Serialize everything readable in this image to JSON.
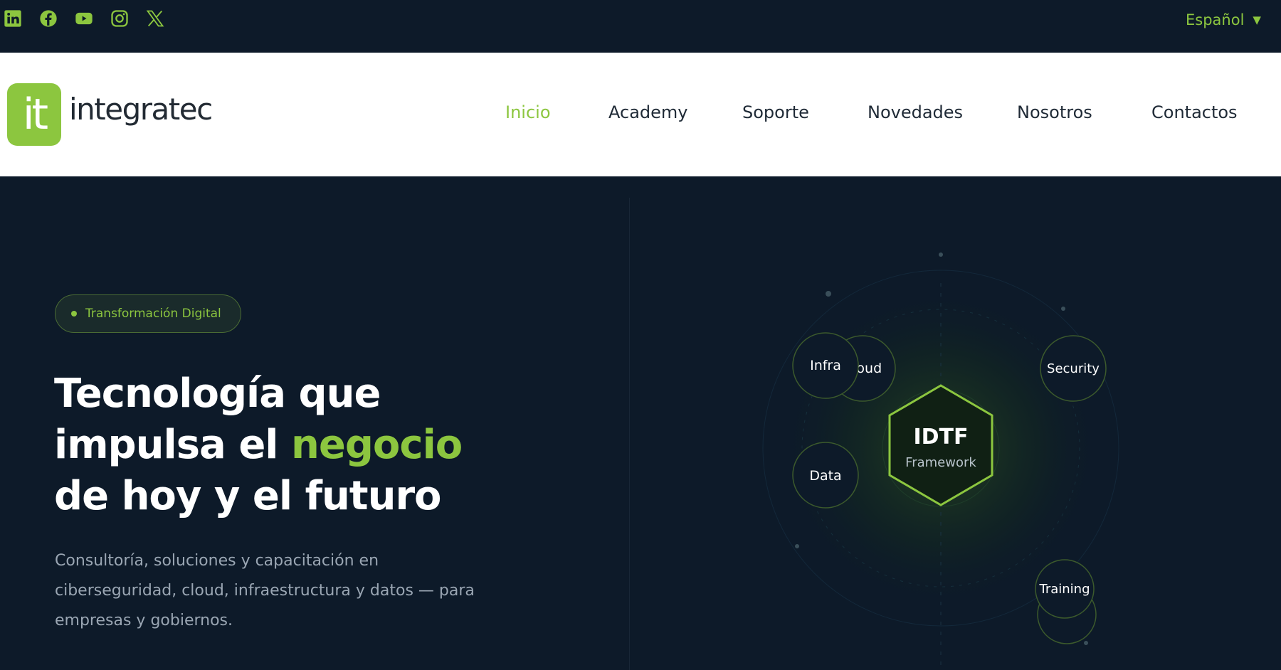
{
  "topbar": {
    "social_icons": [
      "linkedin-icon",
      "facebook-icon",
      "youtube-icon",
      "instagram-icon",
      "x-icon"
    ],
    "language": "Español"
  },
  "header": {
    "logo_mark": "it",
    "logo_text": "integratec",
    "nav": [
      "Inicio",
      "Academy",
      "Soporte",
      "Novedades",
      "Nosotros",
      "Contactos"
    ],
    "active_nav": "Inicio"
  },
  "hero": {
    "badge": "Transformación Digital",
    "headline_line1": "Tecnología que",
    "headline_line2_pre": "impulsa el ",
    "headline_line2_accent": "negocio",
    "headline_line3": "de hoy y el futuro",
    "lead": "Consultoría, soluciones y capacitación en ciberseguridad, cloud, infraestructura y datos — para empresas y gobiernos."
  },
  "diagram": {
    "center_title": "IDTF",
    "center_subtitle": "Framework",
    "nodes": [
      "Infra",
      "Cloud",
      "Security",
      "Data",
      "Training"
    ]
  },
  "colors": {
    "accent": "#8cc63f",
    "dark_bg": "#0d1a29",
    "header_bg": "#ffffff",
    "nav_text": "#1f2a36",
    "muted_text": "#9aa6b3"
  }
}
